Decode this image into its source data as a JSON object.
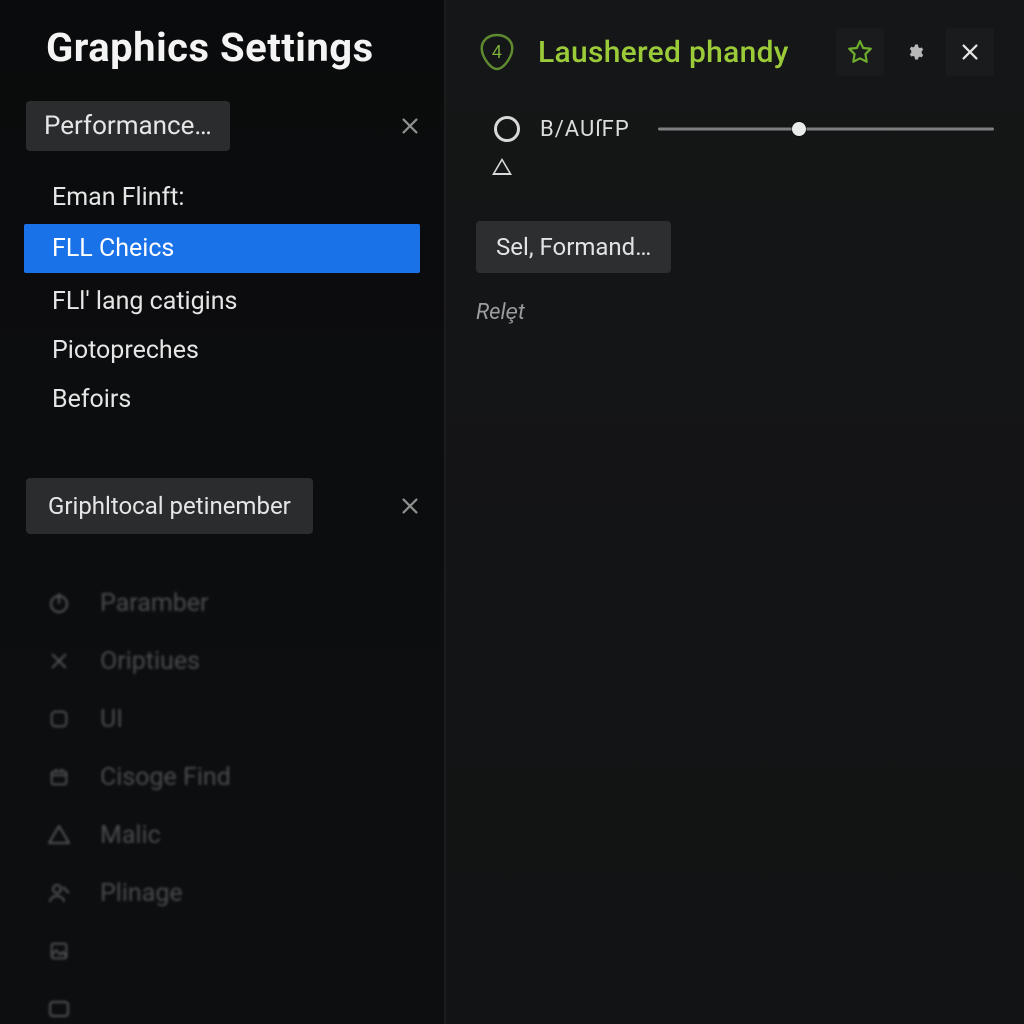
{
  "sidebar": {
    "title": "Graphics Settings",
    "section1": {
      "chip": "Performance…",
      "heading": "Eman Flinft:",
      "items": [
        "FLL Cheics",
        "FLl' lang catigins",
        "Piotopreches",
        "Befoirs"
      ],
      "selected_index": 0
    },
    "section2": {
      "chip": "Griphltocal petinember"
    },
    "faded": [
      {
        "icon": "power-icon",
        "label": "Paramber"
      },
      {
        "icon": "close-icon",
        "label": "Oriptiues"
      },
      {
        "icon": "square-icon",
        "label": "UI"
      },
      {
        "icon": "calendar-icon",
        "label": "Cisoge Find"
      },
      {
        "icon": "warning-icon",
        "label": "Malic"
      },
      {
        "icon": "user-icon",
        "label": "Plinage"
      },
      {
        "icon": "image-icon",
        "label": ""
      },
      {
        "icon": "rect-icon",
        "label": ""
      }
    ]
  },
  "main": {
    "badge_value": "4",
    "title": "Laushered phandy",
    "row1_label": "B/AUſFP",
    "slider_percent": 42,
    "dropdown_label": "Sel, Formand…",
    "helper": "Relȩt"
  },
  "colors": {
    "accent": "#1a72e8",
    "accent_green": "#9ccb3a"
  }
}
